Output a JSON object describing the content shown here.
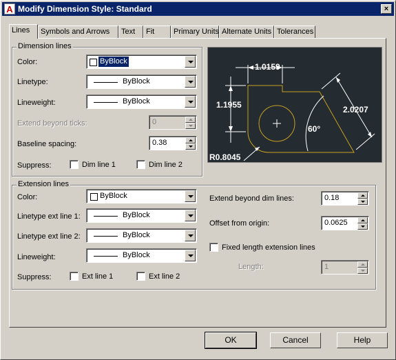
{
  "window": {
    "title": "Modify Dimension Style: Standard",
    "app_icon": "A",
    "close": "×"
  },
  "tabs": [
    {
      "label": "Lines",
      "active": true
    },
    {
      "label": "Symbols and Arrows",
      "active": false
    },
    {
      "label": "Text",
      "active": false
    },
    {
      "label": "Fit",
      "active": false
    },
    {
      "label": "Primary Units",
      "active": false
    },
    {
      "label": "Alternate Units",
      "active": false
    },
    {
      "label": "Tolerances",
      "active": false
    }
  ],
  "dimension_lines": {
    "title": "Dimension lines",
    "color_label": "Color:",
    "color_value": "ByBlock",
    "linetype_label": "Linetype:",
    "linetype_value": "ByBlock",
    "lineweight_label": "Lineweight:",
    "lineweight_value": "ByBlock",
    "extend_label": "Extend beyond ticks:",
    "extend_value": "0",
    "baseline_label": "Baseline spacing:",
    "baseline_value": "0.38",
    "suppress_label": "Suppress:",
    "dim_line_1": "Dim line 1",
    "dim_line_2": "Dim line 2"
  },
  "extension_lines": {
    "title": "Extension lines",
    "color_label": "Color:",
    "color_value": "ByBlock",
    "lt1_label": "Linetype ext line 1:",
    "lt1_value": "ByBlock",
    "lt2_label": "Linetype ext line 2:",
    "lt2_value": "ByBlock",
    "lineweight_label": "Lineweight:",
    "lineweight_value": "ByBlock",
    "suppress_label": "Suppress:",
    "ext_line_1": "Ext line 1",
    "ext_line_2": "Ext line 2",
    "extend_dim_label": "Extend beyond dim lines:",
    "extend_dim_value": "0.18",
    "offset_label": "Offset from origin:",
    "offset_value": "0.0625",
    "fixed_label": "Fixed length extension lines",
    "length_label": "Length:",
    "length_value": "1"
  },
  "preview": {
    "dim_top": "1.0159",
    "dim_left": "1.1955",
    "dim_right": "2.0207",
    "dim_angle": "60°",
    "dim_radius": "R0.8045",
    "colors": {
      "background": "#252c31",
      "geometry": "#c8a020",
      "dims": "#ffffff"
    }
  },
  "buttons": {
    "ok": "OK",
    "cancel": "Cancel",
    "help": "Help"
  }
}
